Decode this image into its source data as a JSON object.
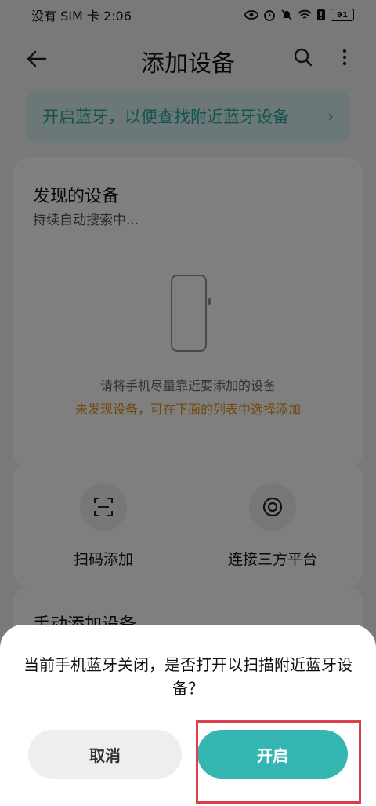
{
  "status_bar": {
    "carrier_time": "没有 SIM 卡 2:06",
    "battery": "91"
  },
  "header": {
    "title": "添加设备"
  },
  "banner": {
    "text": "开启蓝牙，以便查找附近蓝牙设备",
    "chevron": "›"
  },
  "discovered": {
    "title": "发现的设备",
    "subtitle": "持续自动搜索中...",
    "hint": "请将手机尽量靠近要添加的设备",
    "warning": "未发现设备，可在下面的列表中选择添加"
  },
  "actions": {
    "scan_label": "扫码添加",
    "link_label": "连接三方平台"
  },
  "manual": {
    "title": "手动添加设备"
  },
  "dialog": {
    "message": "当前手机蓝牙关闭，是否打开以扫描附近蓝牙设备？",
    "cancel": "取消",
    "confirm": "开启"
  },
  "colors": {
    "accent": "#35b6b3",
    "warning": "#e0931a",
    "highlight": "#d9424a"
  }
}
